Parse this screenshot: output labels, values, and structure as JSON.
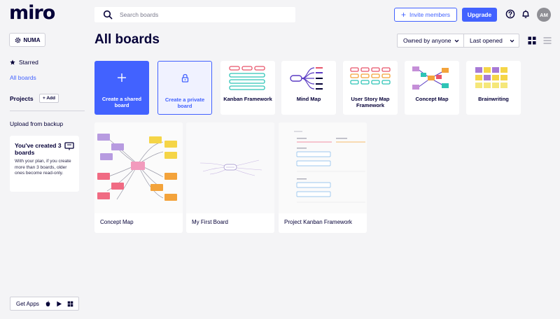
{
  "app": {
    "logo": "miro"
  },
  "header": {
    "search_placeholder": "Search boards",
    "invite_label": "Invite members",
    "upgrade_label": "Upgrade",
    "avatar_initials": "AM",
    "help_icon": "help-icon",
    "bell_icon": "bell-icon"
  },
  "sidebar": {
    "team_label": "NUMA",
    "starred_label": "Starred",
    "all_boards_label": "All boards",
    "projects_label": "Projects",
    "add_label": "+ Add",
    "upload_label": "Upload from backup",
    "plan": {
      "title": "You've created 3 boards",
      "description": "With your plan, if you create more than 3 boards, older ones become read-only."
    },
    "get_apps_label": "Get Apps",
    "app_icons": [
      "apple-icon",
      "google-play-icon",
      "windows-icon"
    ]
  },
  "main": {
    "title": "All boards",
    "owner_filter": "Owned by anyone",
    "sort_filter": "Last opened",
    "templates": [
      {
        "label": "Create a shared board"
      },
      {
        "label": "Create a private board"
      },
      {
        "label": "Kanban Framework"
      },
      {
        "label": "Mind Map"
      },
      {
        "label": "User Story Map Framework"
      },
      {
        "label": "Concept Map"
      },
      {
        "label": "Brainwriting"
      }
    ],
    "boards": [
      {
        "name": "Concept Map"
      },
      {
        "name": "My First Board"
      },
      {
        "name": "Project Kanban Framework"
      }
    ]
  },
  "colors": {
    "accent": "#4262ff",
    "background": "#f4f4f6",
    "text": "#050038"
  }
}
